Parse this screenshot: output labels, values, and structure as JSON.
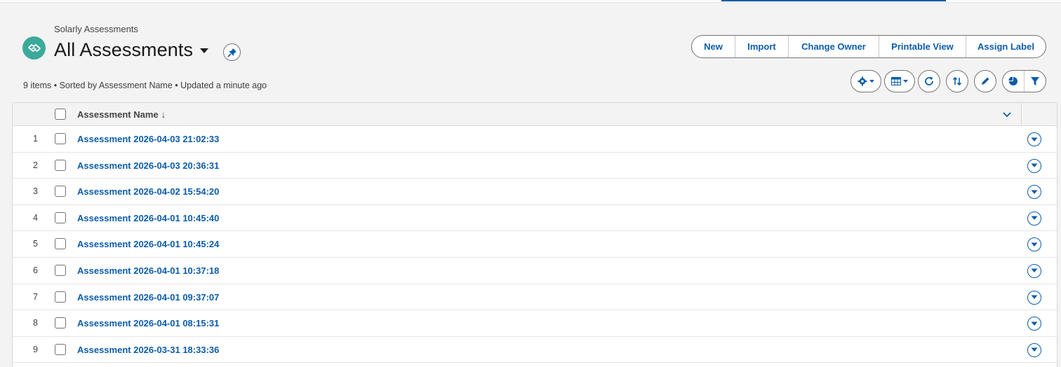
{
  "colors": {
    "accent": "#0b5cab",
    "app_icon_bg": "#3ba99c",
    "page_bg": "#f3f3f3"
  },
  "header": {
    "object_label": "Solarly Assessments",
    "view_title": "All Assessments",
    "app_icon": "handshake-icon",
    "meta": "9 items • Sorted by Assessment Name • Updated a minute ago"
  },
  "actions": [
    {
      "label": "New"
    },
    {
      "label": "Import"
    },
    {
      "label": "Change Owner"
    },
    {
      "label": "Printable View"
    },
    {
      "label": "Assign Label"
    }
  ],
  "toolbar_icons": [
    "gear-icon",
    "table-icon",
    "refresh-icon",
    "sort-icon",
    "pencil-icon",
    "chart-icon",
    "filter-icon"
  ],
  "table": {
    "columns": [
      {
        "label": "Assessment Name",
        "sort": "↓"
      }
    ],
    "rows": [
      {
        "num": "1",
        "name": "Assessment 2026-04-03 21:02:33"
      },
      {
        "num": "2",
        "name": "Assessment 2026-04-03 20:36:31"
      },
      {
        "num": "3",
        "name": "Assessment 2026-04-02 15:54:20"
      },
      {
        "num": "4",
        "name": "Assessment 2026-04-01 10:45:40"
      },
      {
        "num": "5",
        "name": "Assessment 2026-04-01 10:45:24"
      },
      {
        "num": "6",
        "name": "Assessment 2026-04-01 10:37:18"
      },
      {
        "num": "7",
        "name": "Assessment 2026-04-01 09:37:07"
      },
      {
        "num": "8",
        "name": "Assessment 2026-04-01 08:15:31"
      },
      {
        "num": "9",
        "name": "Assessment 2026-03-31 18:33:36"
      }
    ]
  }
}
